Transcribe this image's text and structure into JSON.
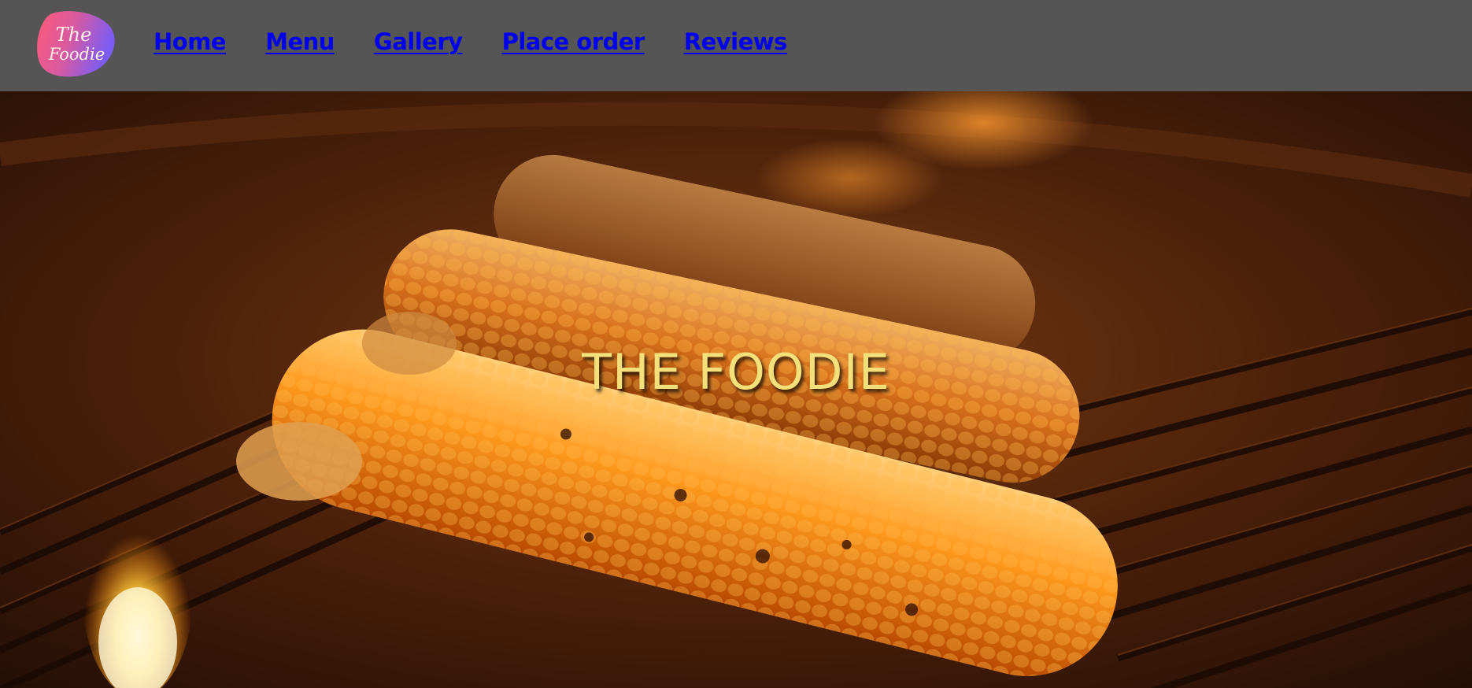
{
  "logo": {
    "line1": "The",
    "line2": "Foodie"
  },
  "nav": {
    "links": [
      "Home",
      "Menu",
      "Gallery",
      "Place order",
      "Reviews"
    ]
  },
  "hero": {
    "title": "THE FOODIE",
    "image_subject": "grilled corn on the cob over flames"
  },
  "colors": {
    "navbar_bg": "#555555",
    "link": "#0000ee",
    "hero_title": "#f4e07a",
    "logo_gradient_start": "#ff5a7a",
    "logo_gradient_end": "#7a5cff"
  }
}
